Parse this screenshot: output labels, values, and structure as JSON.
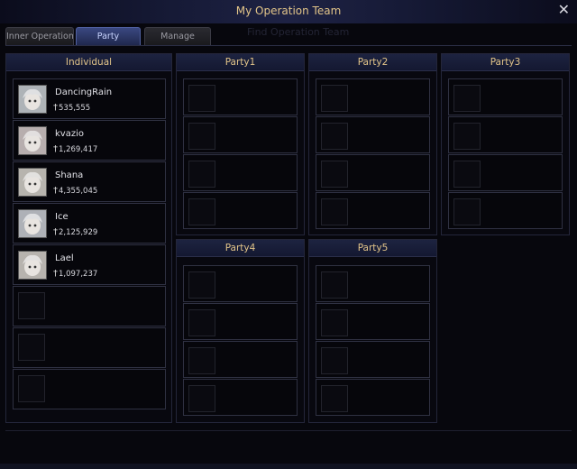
{
  "window": {
    "title": "My Operation Team",
    "ghost_text": "Find Operation Team"
  },
  "tabs": [
    {
      "label": "Inner Operation Te",
      "active": false
    },
    {
      "label": "Party",
      "active": true
    },
    {
      "label": "Manage",
      "active": false
    }
  ],
  "individual": {
    "header": "Individual",
    "members": [
      {
        "name": "DancingRain",
        "power": "535,555"
      },
      {
        "name": "kvazio",
        "power": "1,269,417"
      },
      {
        "name": "Shana",
        "power": "4,355,045"
      },
      {
        "name": "Ice",
        "power": "2,125,929"
      },
      {
        "name": "Lael",
        "power": "1,097,237"
      }
    ],
    "empty_slots": 3
  },
  "parties": [
    {
      "header": "Party1",
      "slots": 4
    },
    {
      "header": "Party2",
      "slots": 4
    },
    {
      "header": "Party3",
      "slots": 4
    },
    {
      "header": "Party4",
      "slots": 4
    },
    {
      "header": "Party5",
      "slots": 4
    }
  ],
  "icons": {
    "close": "close-icon",
    "power": "sword-icon",
    "avatar": "character-portrait"
  },
  "colors": {
    "title_gold": "#e2c489",
    "active_tab": "#3a4880",
    "panel_header": "#1d2340"
  }
}
